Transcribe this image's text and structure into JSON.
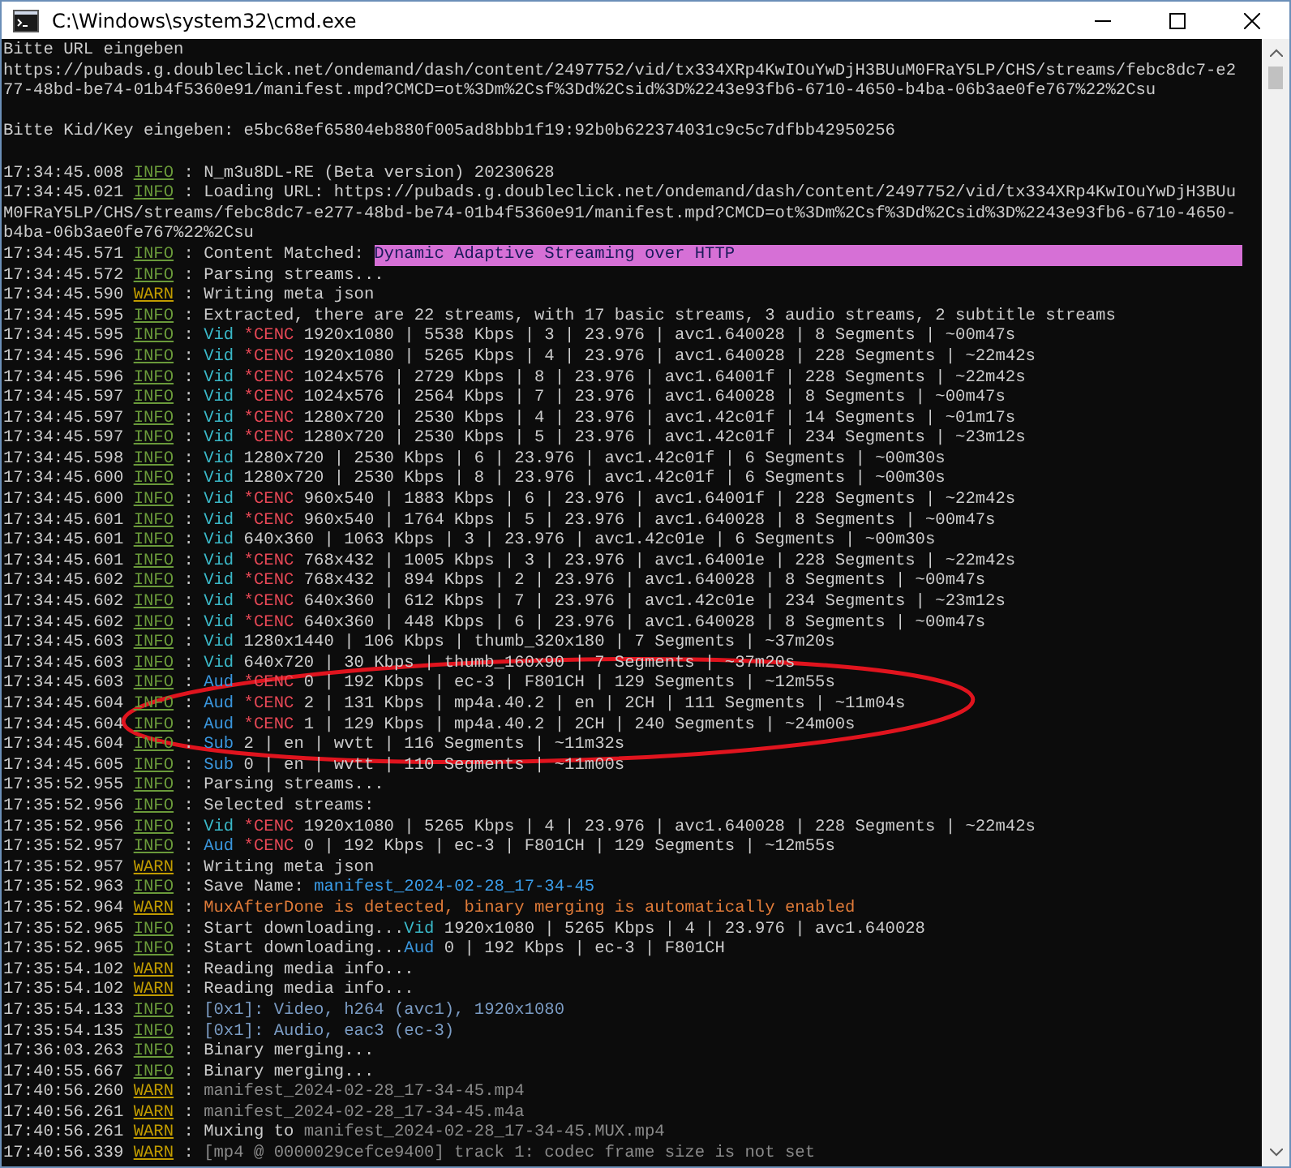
{
  "window": {
    "title": "C:\\Windows\\system32\\cmd.exe"
  },
  "lines": [
    {
      "kind": "text",
      "text": "Bitte URL eingeben"
    },
    {
      "kind": "text",
      "text": "https://pubads.g.doubleclick.net/ondemand/dash/content/2497752/vid/tx334XRp4KwIOuYwDjH3BUuM0FRaY5LP/CHS/streams/febc8dc7-e2"
    },
    {
      "kind": "text",
      "text": "77-48bd-be74-01b4f5360e91/manifest.mpd?CMCD=ot%3Dm%2Csf%3Dd%2Csid%3D%2243e93fb6-6710-4650-b4ba-06b3ae0fe767%22%2Csu"
    },
    {
      "kind": "blank"
    },
    {
      "kind": "text",
      "text": "Bitte Kid/Key eingeben: e5bc68ef65804eb880f005ad8bbb1f19:92b0b622374031c9c5c7dfbb42950256"
    },
    {
      "kind": "blank"
    },
    {
      "kind": "log",
      "time": "17:34:45.008",
      "severity": {
        "kind": "info",
        "text": "INFO"
      },
      "parts": [
        {
          "kind": "plain",
          "text": ": N_m3u8DL-RE (Beta version) 20230628"
        }
      ]
    },
    {
      "kind": "log",
      "time": "17:34:45.021",
      "severity": {
        "kind": "info",
        "text": "INFO"
      },
      "parts": [
        {
          "kind": "plain",
          "text": ": Loading URL: https://pubads.g.doubleclick.net/ondemand/dash/content/2497752/vid/tx334XRp4KwIOuYwDjH3BUu"
        }
      ]
    },
    {
      "kind": "text",
      "text": "M0FRaY5LP/CHS/streams/febc8dc7-e277-48bd-be74-01b4f5360e91/manifest.mpd?CMCD=ot%3Dm%2Csf%3Dd%2Csid%3D%2243e93fb6-6710-4650-"
    },
    {
      "kind": "text",
      "text": "b4ba-06b3ae0fe767%22%2Csu"
    },
    {
      "kind": "log",
      "time": "17:34:45.571",
      "severity": {
        "kind": "info",
        "text": "INFO"
      },
      "parts": [
        {
          "kind": "plain",
          "text": ": Content Matched: "
        },
        {
          "kind": "highlight",
          "text": "Dynamic Adaptive Streaming over HTTP"
        }
      ]
    },
    {
      "kind": "log",
      "time": "17:34:45.572",
      "severity": {
        "kind": "info",
        "text": "INFO"
      },
      "parts": [
        {
          "kind": "plain",
          "text": ": Parsing streams..."
        }
      ]
    },
    {
      "kind": "log",
      "time": "17:34:45.590",
      "severity": {
        "kind": "warn",
        "text": "WARN"
      },
      "parts": [
        {
          "kind": "plain",
          "text": ": Writing meta json"
        }
      ]
    },
    {
      "kind": "log",
      "time": "17:34:45.595",
      "severity": {
        "kind": "info",
        "text": "INFO"
      },
      "parts": [
        {
          "kind": "plain",
          "text": ": Extracted, there are 22 streams, with 17 basic streams, 3 audio streams, 2 subtitle streams"
        }
      ]
    },
    {
      "kind": "log",
      "time": "17:34:45.595",
      "severity": {
        "kind": "info",
        "text": "INFO"
      },
      "parts": [
        {
          "kind": "plain",
          "text": ": "
        },
        {
          "kind": "vid",
          "text": "Vid "
        },
        {
          "kind": "cenc",
          "text": "*CENC "
        },
        {
          "kind": "plain",
          "text": "1920x1080 | 5538 Kbps | 3 | 23.976 | avc1.640028 | 8 Segments | ~00m47s"
        }
      ]
    },
    {
      "kind": "log",
      "time": "17:34:45.596",
      "severity": {
        "kind": "info",
        "text": "INFO"
      },
      "parts": [
        {
          "kind": "plain",
          "text": ": "
        },
        {
          "kind": "vid",
          "text": "Vid "
        },
        {
          "kind": "cenc",
          "text": "*CENC "
        },
        {
          "kind": "plain",
          "text": "1920x1080 | 5265 Kbps | 4 | 23.976 | avc1.640028 | 228 Segments | ~22m42s"
        }
      ]
    },
    {
      "kind": "log",
      "time": "17:34:45.596",
      "severity": {
        "kind": "info",
        "text": "INFO"
      },
      "parts": [
        {
          "kind": "plain",
          "text": ": "
        },
        {
          "kind": "vid",
          "text": "Vid "
        },
        {
          "kind": "cenc",
          "text": "*CENC "
        },
        {
          "kind": "plain",
          "text": "1024x576 | 2729 Kbps | 8 | 23.976 | avc1.64001f | 228 Segments | ~22m42s"
        }
      ]
    },
    {
      "kind": "log",
      "time": "17:34:45.597",
      "severity": {
        "kind": "info",
        "text": "INFO"
      },
      "parts": [
        {
          "kind": "plain",
          "text": ": "
        },
        {
          "kind": "vid",
          "text": "Vid "
        },
        {
          "kind": "cenc",
          "text": "*CENC "
        },
        {
          "kind": "plain",
          "text": "1024x576 | 2564 Kbps | 7 | 23.976 | avc1.640028 | 8 Segments | ~00m47s"
        }
      ]
    },
    {
      "kind": "log",
      "time": "17:34:45.597",
      "severity": {
        "kind": "info",
        "text": "INFO"
      },
      "parts": [
        {
          "kind": "plain",
          "text": ": "
        },
        {
          "kind": "vid",
          "text": "Vid "
        },
        {
          "kind": "cenc",
          "text": "*CENC "
        },
        {
          "kind": "plain",
          "text": "1280x720 | 2530 Kbps | 4 | 23.976 | avc1.42c01f | 14 Segments | ~01m17s"
        }
      ]
    },
    {
      "kind": "log",
      "time": "17:34:45.597",
      "severity": {
        "kind": "info",
        "text": "INFO"
      },
      "parts": [
        {
          "kind": "plain",
          "text": ": "
        },
        {
          "kind": "vid",
          "text": "Vid "
        },
        {
          "kind": "cenc",
          "text": "*CENC "
        },
        {
          "kind": "plain",
          "text": "1280x720 | 2530 Kbps | 5 | 23.976 | avc1.42c01f | 234 Segments | ~23m12s"
        }
      ]
    },
    {
      "kind": "log",
      "time": "17:34:45.598",
      "severity": {
        "kind": "info",
        "text": "INFO"
      },
      "parts": [
        {
          "kind": "plain",
          "text": ": "
        },
        {
          "kind": "vid",
          "text": "Vid "
        },
        {
          "kind": "plain",
          "text": "1280x720 | 2530 Kbps | 6 | 23.976 | avc1.42c01f | 6 Segments | ~00m30s"
        }
      ]
    },
    {
      "kind": "log",
      "time": "17:34:45.600",
      "severity": {
        "kind": "info",
        "text": "INFO"
      },
      "parts": [
        {
          "kind": "plain",
          "text": ": "
        },
        {
          "kind": "vid",
          "text": "Vid "
        },
        {
          "kind": "plain",
          "text": "1280x720 | 2530 Kbps | 8 | 23.976 | avc1.42c01f | 6 Segments | ~00m30s"
        }
      ]
    },
    {
      "kind": "log",
      "time": "17:34:45.600",
      "severity": {
        "kind": "info",
        "text": "INFO"
      },
      "parts": [
        {
          "kind": "plain",
          "text": ": "
        },
        {
          "kind": "vid",
          "text": "Vid "
        },
        {
          "kind": "cenc",
          "text": "*CENC "
        },
        {
          "kind": "plain",
          "text": "960x540 | 1883 Kbps | 6 | 23.976 | avc1.64001f | 228 Segments | ~22m42s"
        }
      ]
    },
    {
      "kind": "log",
      "time": "17:34:45.601",
      "severity": {
        "kind": "info",
        "text": "INFO"
      },
      "parts": [
        {
          "kind": "plain",
          "text": ": "
        },
        {
          "kind": "vid",
          "text": "Vid "
        },
        {
          "kind": "cenc",
          "text": "*CENC "
        },
        {
          "kind": "plain",
          "text": "960x540 | 1764 Kbps | 5 | 23.976 | avc1.640028 | 8 Segments | ~00m47s"
        }
      ]
    },
    {
      "kind": "log",
      "time": "17:34:45.601",
      "severity": {
        "kind": "info",
        "text": "INFO"
      },
      "parts": [
        {
          "kind": "plain",
          "text": ": "
        },
        {
          "kind": "vid",
          "text": "Vid "
        },
        {
          "kind": "plain",
          "text": "640x360 | 1063 Kbps | 3 | 23.976 | avc1.42c01e | 6 Segments | ~00m30s"
        }
      ]
    },
    {
      "kind": "log",
      "time": "17:34:45.601",
      "severity": {
        "kind": "info",
        "text": "INFO"
      },
      "parts": [
        {
          "kind": "plain",
          "text": ": "
        },
        {
          "kind": "vid",
          "text": "Vid "
        },
        {
          "kind": "cenc",
          "text": "*CENC "
        },
        {
          "kind": "plain",
          "text": "768x432 | 1005 Kbps | 3 | 23.976 | avc1.64001e | 228 Segments | ~22m42s"
        }
      ]
    },
    {
      "kind": "log",
      "time": "17:34:45.602",
      "severity": {
        "kind": "info",
        "text": "INFO"
      },
      "parts": [
        {
          "kind": "plain",
          "text": ": "
        },
        {
          "kind": "vid",
          "text": "Vid "
        },
        {
          "kind": "cenc",
          "text": "*CENC "
        },
        {
          "kind": "plain",
          "text": "768x432 | 894 Kbps | 2 | 23.976 | avc1.640028 | 8 Segments | ~00m47s"
        }
      ]
    },
    {
      "kind": "log",
      "time": "17:34:45.602",
      "severity": {
        "kind": "info",
        "text": "INFO"
      },
      "parts": [
        {
          "kind": "plain",
          "text": ": "
        },
        {
          "kind": "vid",
          "text": "Vid "
        },
        {
          "kind": "cenc",
          "text": "*CENC "
        },
        {
          "kind": "plain",
          "text": "640x360 | 612 Kbps | 7 | 23.976 | avc1.42c01e | 234 Segments | ~23m12s"
        }
      ]
    },
    {
      "kind": "log",
      "time": "17:34:45.602",
      "severity": {
        "kind": "info",
        "text": "INFO"
      },
      "parts": [
        {
          "kind": "plain",
          "text": ": "
        },
        {
          "kind": "vid",
          "text": "Vid "
        },
        {
          "kind": "cenc",
          "text": "*CENC "
        },
        {
          "kind": "plain",
          "text": "640x360 | 448 Kbps | 6 | 23.976 | avc1.640028 | 8 Segments | ~00m47s"
        }
      ]
    },
    {
      "kind": "log",
      "time": "17:34:45.603",
      "severity": {
        "kind": "info",
        "text": "INFO"
      },
      "parts": [
        {
          "kind": "plain",
          "text": ": "
        },
        {
          "kind": "vid",
          "text": "Vid "
        },
        {
          "kind": "plain",
          "text": "1280x1440 | 106 Kbps | thumb_320x180 | 7 Segments | ~37m20s"
        }
      ]
    },
    {
      "kind": "log",
      "time": "17:34:45.603",
      "severity": {
        "kind": "info",
        "text": "INFO"
      },
      "parts": [
        {
          "kind": "plain",
          "text": ": "
        },
        {
          "kind": "vid",
          "text": "Vid "
        },
        {
          "kind": "plain",
          "text": "640x720 | 30 Kbps | thumb_160x90 | 7 Segments | ~37m20s"
        }
      ]
    },
    {
      "kind": "log",
      "time": "17:34:45.603",
      "severity": {
        "kind": "info",
        "text": "INFO"
      },
      "parts": [
        {
          "kind": "plain",
          "text": ": "
        },
        {
          "kind": "aud",
          "text": "Aud "
        },
        {
          "kind": "cenc",
          "text": "*CENC "
        },
        {
          "kind": "plain",
          "text": "0 | 192 Kbps | ec-3 | F801CH | 129 Segments | ~12m55s"
        }
      ]
    },
    {
      "kind": "log",
      "time": "17:34:45.604",
      "severity": {
        "kind": "info",
        "text": "INFO"
      },
      "parts": [
        {
          "kind": "plain",
          "text": ": "
        },
        {
          "kind": "aud",
          "text": "Aud "
        },
        {
          "kind": "cenc",
          "text": "*CENC "
        },
        {
          "kind": "plain",
          "text": "2 | 131 Kbps | mp4a.40.2 | en | 2CH | 111 Segments | ~11m04s"
        }
      ]
    },
    {
      "kind": "log",
      "time": "17:34:45.604",
      "severity": {
        "kind": "info",
        "text": "INFO"
      },
      "parts": [
        {
          "kind": "plain",
          "text": ": "
        },
        {
          "kind": "aud",
          "text": "Aud "
        },
        {
          "kind": "cenc",
          "text": "*CENC "
        },
        {
          "kind": "plain",
          "text": "1 | 129 Kbps | mp4a.40.2 | 2CH | 240 Segments | ~24m00s"
        }
      ]
    },
    {
      "kind": "log",
      "time": "17:34:45.604",
      "severity": {
        "kind": "info",
        "text": "INFO"
      },
      "parts": [
        {
          "kind": "plain",
          "text": ": "
        },
        {
          "kind": "aud",
          "text": "Sub "
        },
        {
          "kind": "plain",
          "text": "2 | en | wvtt | 116 Segments | ~11m32s"
        }
      ]
    },
    {
      "kind": "log",
      "time": "17:34:45.605",
      "severity": {
        "kind": "info",
        "text": "INFO"
      },
      "parts": [
        {
          "kind": "plain",
          "text": ": "
        },
        {
          "kind": "aud",
          "text": "Sub "
        },
        {
          "kind": "plain",
          "text": "0 | en | wvtt | 110 Segments | ~11m00s"
        }
      ]
    },
    {
      "kind": "log",
      "time": "17:35:52.955",
      "severity": {
        "kind": "info",
        "text": "INFO"
      },
      "parts": [
        {
          "kind": "plain",
          "text": ": Parsing streams..."
        }
      ]
    },
    {
      "kind": "log",
      "time": "17:35:52.956",
      "severity": {
        "kind": "info",
        "text": "INFO"
      },
      "parts": [
        {
          "kind": "plain",
          "text": ": Selected streams:"
        }
      ]
    },
    {
      "kind": "log",
      "time": "17:35:52.956",
      "severity": {
        "kind": "info",
        "text": "INFO"
      },
      "parts": [
        {
          "kind": "plain",
          "text": ": "
        },
        {
          "kind": "vid",
          "text": "Vid "
        },
        {
          "kind": "cenc",
          "text": "*CENC "
        },
        {
          "kind": "plain",
          "text": "1920x1080 | 5265 Kbps | 4 | 23.976 | avc1.640028 | 228 Segments | ~22m42s"
        }
      ]
    },
    {
      "kind": "log",
      "time": "17:35:52.957",
      "severity": {
        "kind": "info",
        "text": "INFO"
      },
      "parts": [
        {
          "kind": "plain",
          "text": ": "
        },
        {
          "kind": "aud",
          "text": "Aud "
        },
        {
          "kind": "cenc",
          "text": "*CENC "
        },
        {
          "kind": "plain",
          "text": "0 | 192 Kbps | ec-3 | F801CH | 129 Segments | ~12m55s"
        }
      ]
    },
    {
      "kind": "log",
      "time": "17:35:52.957",
      "severity": {
        "kind": "warn",
        "text": "WARN"
      },
      "parts": [
        {
          "kind": "plain",
          "text": ": Writing meta json"
        }
      ]
    },
    {
      "kind": "log",
      "time": "17:35:52.963",
      "severity": {
        "kind": "info",
        "text": "INFO"
      },
      "parts": [
        {
          "kind": "plain",
          "text": ": Save Name: "
        },
        {
          "kind": "link",
          "text": "manifest_2024-02-28_17-34-45"
        }
      ]
    },
    {
      "kind": "log",
      "time": "17:35:52.964",
      "severity": {
        "kind": "warn",
        "text": "WARN"
      },
      "parts": [
        {
          "kind": "plain",
          "text": ": "
        },
        {
          "kind": "warning",
          "text": "MuxAfterDone is detected, binary merging is automatically enabled"
        }
      ]
    },
    {
      "kind": "log",
      "time": "17:35:52.965",
      "severity": {
        "kind": "info",
        "text": "INFO"
      },
      "parts": [
        {
          "kind": "plain",
          "text": ": Start downloading..."
        },
        {
          "kind": "vid",
          "text": "Vid "
        },
        {
          "kind": "plain",
          "text": "1920x1080 | 5265 Kbps | 4 | 23.976 | avc1.640028"
        }
      ]
    },
    {
      "kind": "log",
      "time": "17:35:52.965",
      "severity": {
        "kind": "info",
        "text": "INFO"
      },
      "parts": [
        {
          "kind": "plain",
          "text": ": Start downloading..."
        },
        {
          "kind": "aud",
          "text": "Aud "
        },
        {
          "kind": "plain",
          "text": "0 | 192 Kbps | ec-3 | F801CH"
        }
      ]
    },
    {
      "kind": "log",
      "time": "17:35:54.102",
      "severity": {
        "kind": "warn",
        "text": "WARN"
      },
      "parts": [
        {
          "kind": "plain",
          "text": ": Reading media info..."
        }
      ]
    },
    {
      "kind": "log",
      "time": "17:35:54.102",
      "severity": {
        "kind": "warn",
        "text": "WARN"
      },
      "parts": [
        {
          "kind": "plain",
          "text": ": Reading media info..."
        }
      ]
    },
    {
      "kind": "log",
      "time": "17:35:54.133",
      "severity": {
        "kind": "info",
        "text": "INFO"
      },
      "parts": [
        {
          "kind": "plain",
          "text": ": "
        },
        {
          "kind": "media",
          "text": "[0x1]: Video, h264 (avc1), 1920x1080"
        }
      ]
    },
    {
      "kind": "log",
      "time": "17:35:54.135",
      "severity": {
        "kind": "info",
        "text": "INFO"
      },
      "parts": [
        {
          "kind": "plain",
          "text": ": "
        },
        {
          "kind": "media",
          "text": "[0x1]: Audio, eac3 (ec-3)"
        }
      ]
    },
    {
      "kind": "log",
      "time": "17:36:03.263",
      "severity": {
        "kind": "info",
        "text": "INFO"
      },
      "parts": [
        {
          "kind": "plain",
          "text": ": Binary merging..."
        }
      ]
    },
    {
      "kind": "log",
      "time": "17:40:55.667",
      "severity": {
        "kind": "info",
        "text": "INFO"
      },
      "parts": [
        {
          "kind": "plain",
          "text": ": Binary merging..."
        }
      ]
    },
    {
      "kind": "log",
      "time": "17:40:56.260",
      "severity": {
        "kind": "warn",
        "text": "WARN"
      },
      "parts": [
        {
          "kind": "plain",
          "text": ": "
        },
        {
          "kind": "muted",
          "text": "manifest_2024-02-28_17-34-45.mp4"
        }
      ]
    },
    {
      "kind": "log",
      "time": "17:40:56.261",
      "severity": {
        "kind": "warn",
        "text": "WARN"
      },
      "parts": [
        {
          "kind": "plain",
          "text": ": "
        },
        {
          "kind": "muted",
          "text": "manifest_2024-02-28_17-34-45.m4a"
        }
      ]
    },
    {
      "kind": "log",
      "time": "17:40:56.261",
      "severity": {
        "kind": "warn",
        "text": "WARN"
      },
      "parts": [
        {
          "kind": "plain",
          "text": ": Muxing to "
        },
        {
          "kind": "muted",
          "text": "manifest_2024-02-28_17-34-45.MUX.mp4"
        }
      ]
    },
    {
      "kind": "log",
      "time": "17:40:56.339",
      "severity": {
        "kind": "warn",
        "text": "WARN"
      },
      "parts": [
        {
          "kind": "plain",
          "text": ": "
        },
        {
          "kind": "muted",
          "text": "[mp4 @ 0000029cefce9400] track 1: codec frame size is not set"
        }
      ]
    }
  ],
  "annotation": {
    "kind": "ellipse"
  }
}
